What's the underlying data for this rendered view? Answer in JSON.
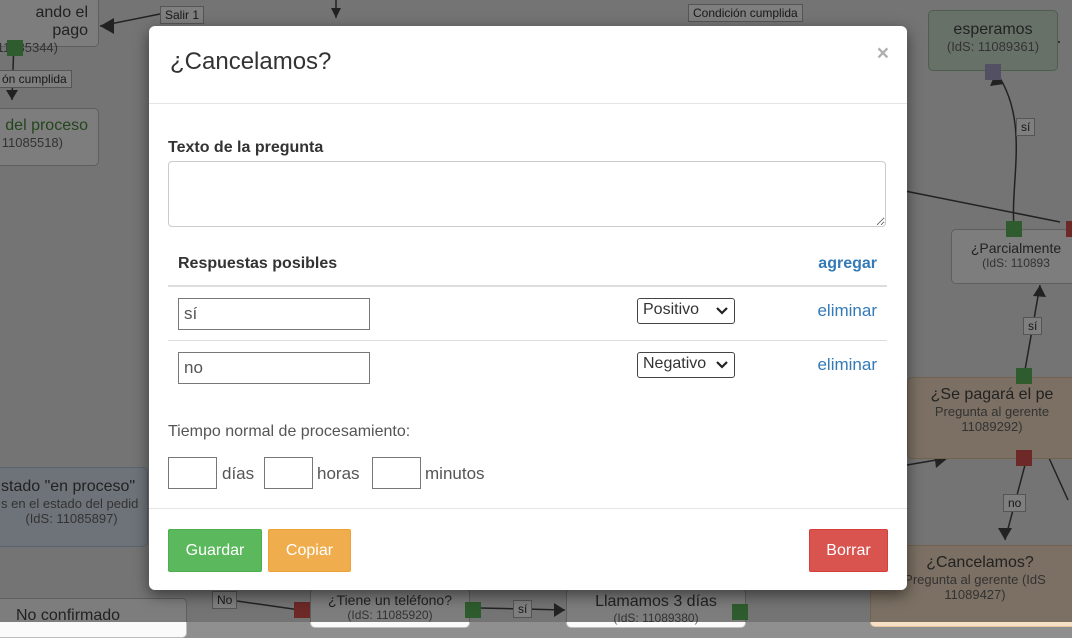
{
  "background": {
    "nodes": [
      {
        "title": "ando el pago",
        "sub": "11085344)"
      },
      {
        "title": "del proceso",
        "sub": "11085518)"
      },
      {
        "title": "esperamos",
        "sub": "(IdS: 11089361)"
      },
      {
        "title": "¿Parcialmente",
        "sub": "(IdS: 110893"
      },
      {
        "title": "¿Se pagará el pe",
        "sub": "Pregunta al gerente",
        "sub2": "11089292)"
      },
      {
        "title": "stado \"en proceso\"",
        "sub": "s en el estado del pedid",
        "sub2": "(IdS: 11085897)"
      },
      {
        "title": "¿Cancelamos?",
        "sub": "Pregunta al gerente (IdS",
        "sub2": "11089427)"
      },
      {
        "title": "No confirmado"
      },
      {
        "title": "¿Tiene un teléfono?",
        "sub": "(IdS: 11085920)"
      },
      {
        "title": "Llamamos 3 días",
        "sub": "(IdS: 11089380)"
      }
    ],
    "labels": [
      "Salir 1",
      "Condición cumplida",
      "ón cumplida",
      "sí",
      "sí",
      "no",
      "No",
      "sí"
    ]
  },
  "modal": {
    "title": "¿Cancelamos?",
    "close_icon": "×",
    "question_label": "Texto de la pregunta",
    "question_value": "",
    "answers_header": "Respuestas posibles",
    "add_label": "agregar",
    "answers": [
      {
        "text": "sí",
        "type": "Positivo",
        "delete_label": "eliminar"
      },
      {
        "text": "no",
        "type": "Negativo",
        "delete_label": "eliminar"
      }
    ],
    "processing_label": "Tiempo normal de procesamiento:",
    "units": {
      "days": "días",
      "hours": "horas",
      "minutes": "minutos"
    },
    "buttons": {
      "save": "Guardar",
      "copy": "Copiar",
      "delete": "Borrar"
    }
  }
}
